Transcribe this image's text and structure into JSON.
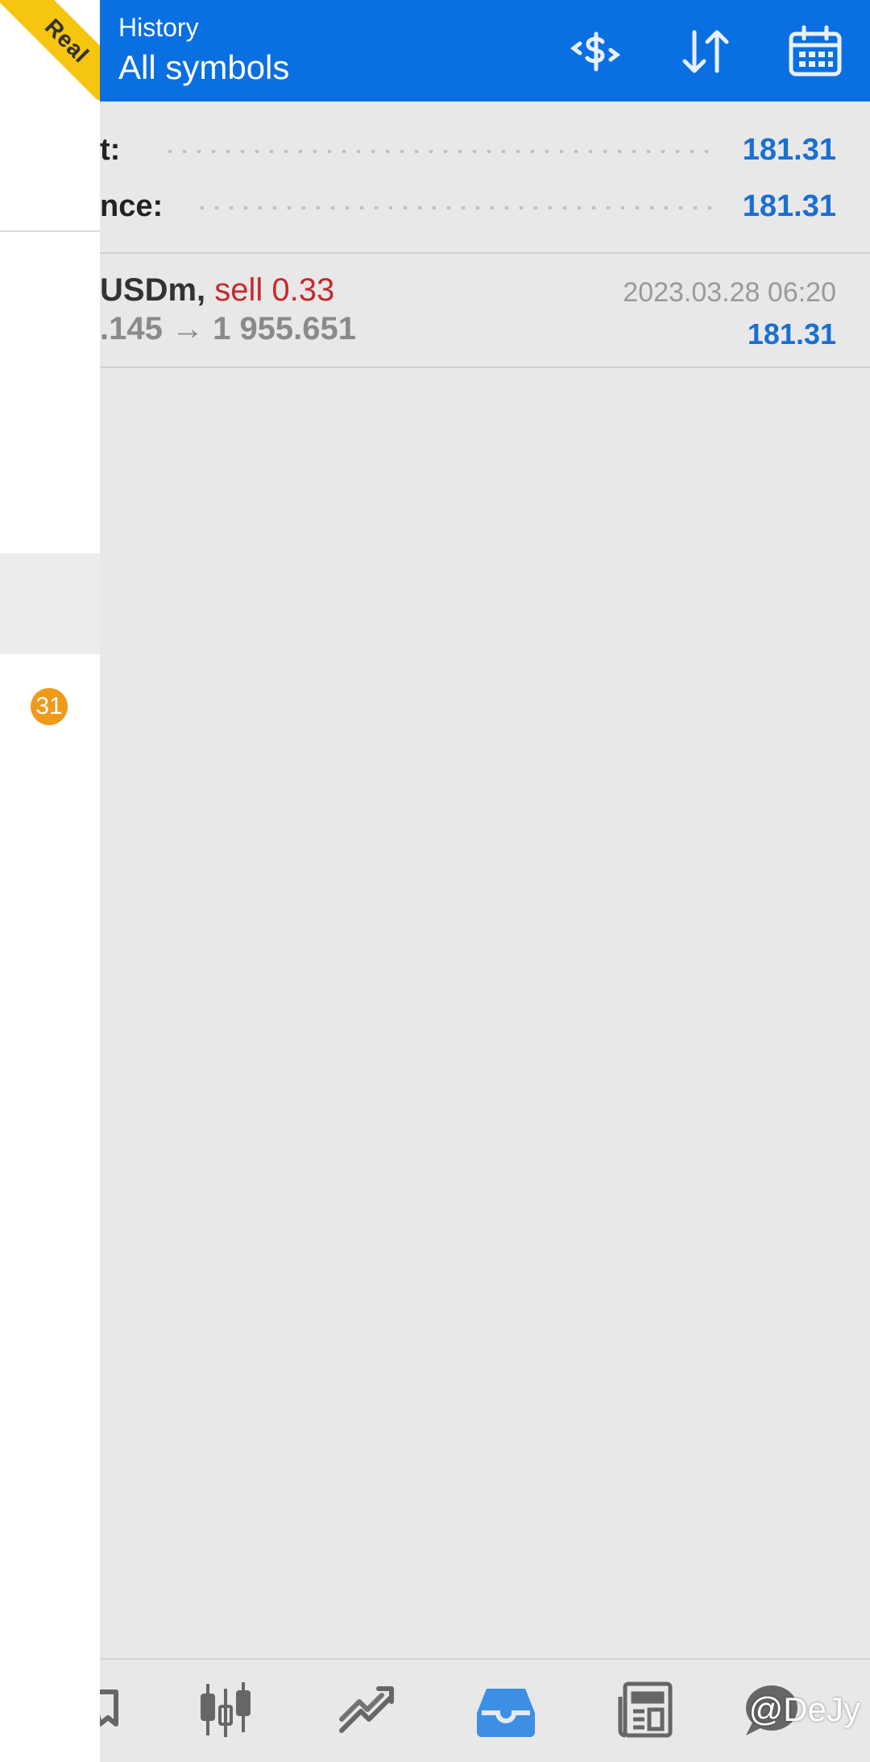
{
  "header": {
    "subtitle": "History",
    "title": "All symbols",
    "actions": [
      {
        "icon": "currency-exchange-icon"
      },
      {
        "icon": "sort-icon"
      },
      {
        "icon": "calendar-icon"
      }
    ]
  },
  "account_badge": "Real",
  "summary": {
    "profit_label": "t:",
    "profit_value": "181.31",
    "balance_label": "nce:",
    "balance_value": "181.31"
  },
  "trade": {
    "symbol": "USDm,",
    "direction": "sell 0.33",
    "prices": ".145 → 1 955.651",
    "time": "2023.03.28 06:20",
    "profit": "181.31"
  },
  "drawer": {
    "badge_count": "31"
  },
  "bottom_nav": [
    {
      "icon": "quotes-icon"
    },
    {
      "icon": "chart-icon"
    },
    {
      "icon": "trade-icon"
    },
    {
      "icon": "history-icon",
      "active": true
    },
    {
      "icon": "news-icon"
    },
    {
      "icon": "messages-icon"
    }
  ],
  "watermark": "@DeJy",
  "colors": {
    "header_bg": "#0a6fe0",
    "profit_blue": "#1a6fd0",
    "sell_red": "#c8282c",
    "badge_orange": "#f09a1a",
    "ribbon_yellow": "#f6c510",
    "active_nav": "#3d8fe6"
  }
}
